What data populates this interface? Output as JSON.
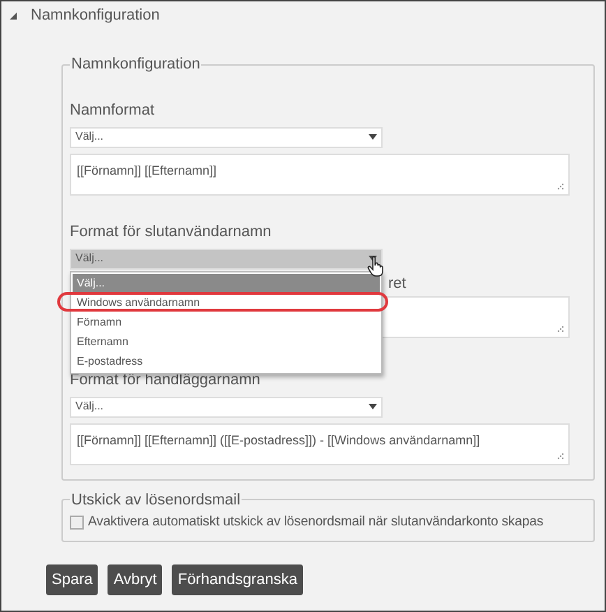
{
  "section": {
    "title": "Namnkonfiguration",
    "expanded": true
  },
  "name_config": {
    "legend": "Namnkonfiguration",
    "fields": [
      {
        "label": "Namnformat",
        "select": "Välj...",
        "open": false,
        "value": "[[Förnamn]] [[Efternamn]]"
      },
      {
        "label": "Format för slutanvändarnamn",
        "select": "Välj...",
        "open": true,
        "next_label_tail": "ret"
      },
      {
        "label": "Format för handläggarnamn",
        "select": "Välj...",
        "open": false,
        "value": "[[Förnamn]] [[Efternamn]] ([[E-postadress]]) - [[Windows användarnamn]]"
      }
    ]
  },
  "dropdown": {
    "options": [
      {
        "label": "Välj...",
        "selected": true,
        "circled": false
      },
      {
        "label": "Windows användarnamn",
        "selected": false,
        "circled": true
      },
      {
        "label": "Förnamn",
        "selected": false,
        "circled": false
      },
      {
        "label": "Efternamn",
        "selected": false,
        "circled": false
      },
      {
        "label": "E-postadress",
        "selected": false,
        "circled": false
      }
    ]
  },
  "password_mail": {
    "legend": "Utskick av lösenordsmail",
    "checkbox": {
      "label": "Avaktivera automatiskt utskick av lösenordsmail när slutanvändarkonto skapas",
      "checked": false
    }
  },
  "buttons": [
    "Spara",
    "Avbryt",
    "Förhandsgranska"
  ]
}
